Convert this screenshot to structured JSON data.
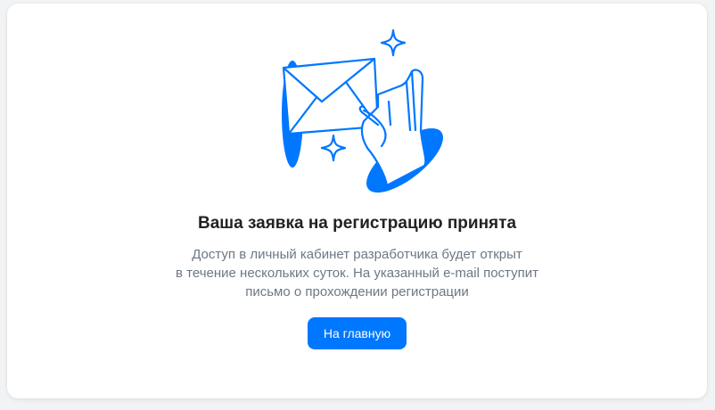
{
  "confirmation": {
    "title": "Ваша заявка на регистрацию принята",
    "description_lines": [
      "Доступ в личный кабинет разработчика будет открыт",
      "в течение нескольких суток. На указанный e-mail поступит",
      "письмо о прохождении регистрации"
    ],
    "home_button_label": "На главную"
  },
  "illustration": {
    "icon": "envelope-hand-icon",
    "accent_color": "#0077ff"
  },
  "colors": {
    "accent": "#0077ff",
    "title": "#222222",
    "text_secondary": "#6d7885",
    "background": "#f2f3f5",
    "card": "#ffffff"
  }
}
